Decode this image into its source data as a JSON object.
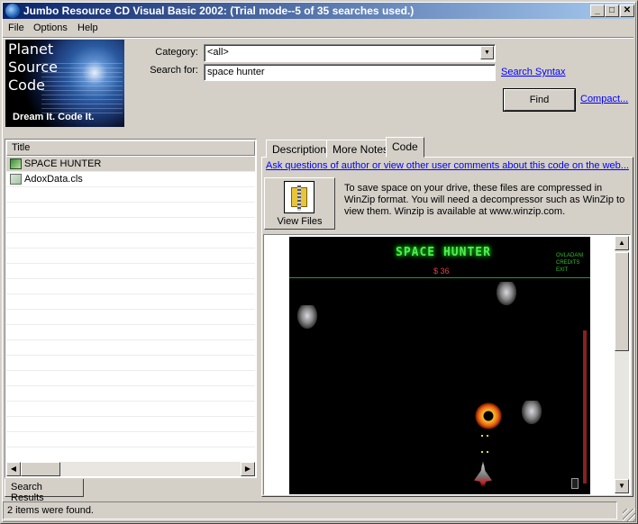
{
  "window": {
    "title": "Jumbo Resource CD Visual Basic 2002: (Trial mode--5 of 35 searches used.)",
    "minimize": "_",
    "maximize": "□",
    "close": "✕"
  },
  "menu": {
    "file": "File",
    "options": "Options",
    "help": "Help"
  },
  "logo": {
    "line1": "Planet",
    "line2": "Source",
    "line3": "Code",
    "tagline": "Dream It.  Code It."
  },
  "search": {
    "category_label": "Category:",
    "category_value": "<all>",
    "search_label": "Search for:",
    "search_value": "space hunter",
    "syntax_link": "Search Syntax",
    "find_button": "Find",
    "compact_link": "Compact..."
  },
  "results": {
    "column_title": "Title",
    "items": [
      {
        "label": "SPACE HUNTER",
        "icon": "vb-project-icon",
        "selected": true
      },
      {
        "label": "AdoxData.cls",
        "icon": "class-file-icon",
        "selected": false
      }
    ],
    "tab_label": "Search Results"
  },
  "detail": {
    "tabs": [
      "Description",
      "More Notes",
      "Code"
    ],
    "active_tab": "Code",
    "ask_link": "Ask questions of author or view other user comments about this code on the web...",
    "view_files_label": "View Files",
    "description": "To save space on your drive, these files are compressed in WinZip format.  You will need a decompressor such as WinZip to view them.  Winzip is available at www.winzip.com."
  },
  "game": {
    "title": "SPACE HUNTER",
    "money": "$ 36",
    "menu": [
      "OVLADANI",
      "CREDITS",
      "EXIT"
    ]
  },
  "status": {
    "text": "2 items were found."
  },
  "colors": {
    "titlebar_start": "#0a246a",
    "titlebar_end": "#a6caf0",
    "face": "#d4d0c8",
    "link": "#0000ff"
  }
}
